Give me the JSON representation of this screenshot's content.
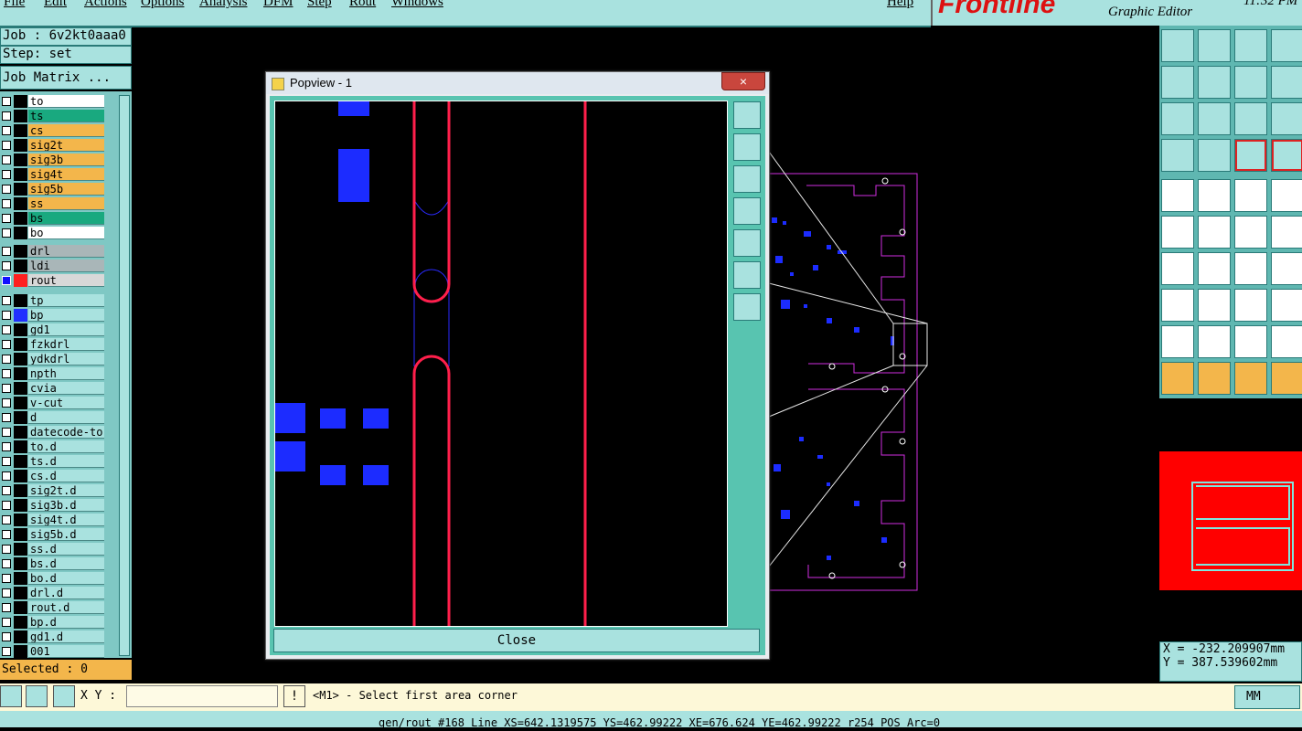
{
  "menu": [
    "File",
    "Edit",
    "Actions",
    "Options",
    "Analysis",
    "DFM",
    "Step",
    "Rout",
    "Windows",
    "Help"
  ],
  "brand": "Frontline",
  "app_title": "Graphic Editor",
  "clock": "11:32 PM",
  "job": "Job : 6v2kt0aaa0",
  "step": "Step: set",
  "job_matrix": "Job Matrix ...",
  "layers": [
    {
      "name": "to",
      "color": "#ffffff"
    },
    {
      "name": "ts",
      "color": "#19a97f"
    },
    {
      "name": "cs",
      "color": "#f3b64b"
    },
    {
      "name": "sig2t",
      "color": "#f3b64b"
    },
    {
      "name": "sig3b",
      "color": "#f3b64b"
    },
    {
      "name": "sig4t",
      "color": "#f3b64b"
    },
    {
      "name": "sig5b",
      "color": "#f3b64b"
    },
    {
      "name": "ss",
      "color": "#f3b64b"
    },
    {
      "name": "bs",
      "color": "#19a97f"
    },
    {
      "name": "bo",
      "color": "#ffffff"
    },
    {
      "name": "drl",
      "color": "#a9b6b8"
    },
    {
      "name": "ldi",
      "color": "#a9b6b8"
    },
    {
      "name": "rout",
      "color": "#d8d8d8"
    },
    {
      "name": "tp",
      "color": "#a9e2df"
    },
    {
      "name": "bp",
      "color": "#a9e2df"
    },
    {
      "name": "gd1",
      "color": "#a9e2df"
    },
    {
      "name": "fzkdrl",
      "color": "#a9e2df"
    },
    {
      "name": "ydkdrl",
      "color": "#a9e2df"
    },
    {
      "name": "npth",
      "color": "#a9e2df"
    },
    {
      "name": "cvia",
      "color": "#a9e2df"
    },
    {
      "name": "v-cut",
      "color": "#a9e2df"
    },
    {
      "name": "d",
      "color": "#a9e2df"
    },
    {
      "name": "datecode-to",
      "color": "#a9e2df"
    },
    {
      "name": "to.d",
      "color": "#a9e2df"
    },
    {
      "name": "ts.d",
      "color": "#a9e2df"
    },
    {
      "name": "cs.d",
      "color": "#a9e2df"
    },
    {
      "name": "sig2t.d",
      "color": "#a9e2df"
    },
    {
      "name": "sig3b.d",
      "color": "#a9e2df"
    },
    {
      "name": "sig4t.d",
      "color": "#a9e2df"
    },
    {
      "name": "sig5b.d",
      "color": "#a9e2df"
    },
    {
      "name": "ss.d",
      "color": "#a9e2df"
    },
    {
      "name": "bs.d",
      "color": "#a9e2df"
    },
    {
      "name": "bo.d",
      "color": "#a9e2df"
    },
    {
      "name": "drl.d",
      "color": "#a9e2df"
    },
    {
      "name": "rout.d",
      "color": "#a9e2df"
    },
    {
      "name": "bp.d",
      "color": "#a9e2df"
    },
    {
      "name": "gd1.d",
      "color": "#a9e2df"
    },
    {
      "name": "001",
      "color": "#a9e2df"
    }
  ],
  "popview": {
    "title": "Popview - 1",
    "close_x": "×",
    "close_label": "Close"
  },
  "coords": {
    "x": "X = -232.209907mm",
    "y": "Y = 387.539602mm"
  },
  "selected": "Selected : 0",
  "xy_label": "X Y :",
  "xy_value": "",
  "prompt": "<M1> - Select first area corner",
  "unit": "MM",
  "status": "gen/rout #168 Line XS=642.1319575 YS=462.99222 XE=676.624 YE=462.99222 r254 POS Arc=0"
}
